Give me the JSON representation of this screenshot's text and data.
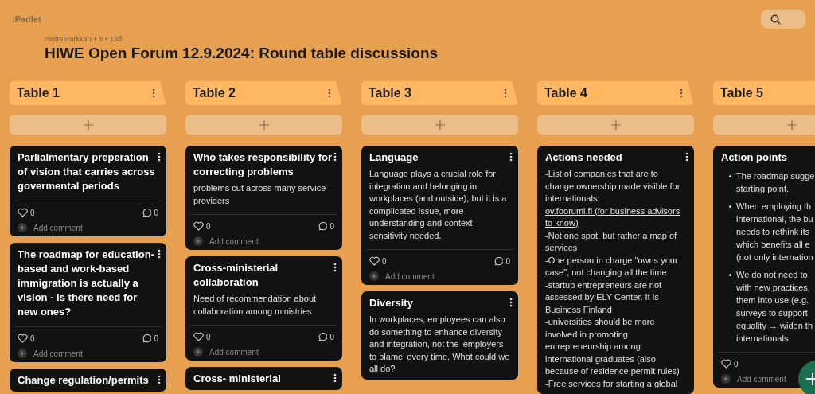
{
  "header": {
    "logo": ":Padlet",
    "meta": "Piritta Parkkari + 8 •  13d",
    "title": "HIWE Open Forum 12.9.2024: Round table discussions"
  },
  "columns": [
    {
      "title": "Table 1",
      "cards": [
        {
          "title": "Parlialmentary preperation of vision that carries across govermental periods",
          "likes": "0",
          "comments": "0",
          "add_comment": "Add comment"
        },
        {
          "title": "The roadmap for education-based and work-based immigration is actually a vision - is there need for new ones?",
          "likes": "0",
          "comments": "0",
          "add_comment": "Add comment"
        },
        {
          "title": "Change regulation/permits"
        }
      ]
    },
    {
      "title": "Table 2",
      "cards": [
        {
          "title": "Who takes responsibility for correcting problems",
          "body": [
            {
              "text": "problems cut across many service providers"
            }
          ],
          "likes": "0",
          "comments": "0",
          "add_comment": "Add comment"
        },
        {
          "title": "Cross-ministerial collaboration",
          "body": [
            {
              "text": "Need of recommendation about collaboration among ministries"
            }
          ],
          "likes": "0",
          "comments": "0",
          "add_comment": "Add comment"
        },
        {
          "title": "Cross- ministerial"
        }
      ]
    },
    {
      "title": "Table 3",
      "cards": [
        {
          "title": "Language",
          "body": [
            {
              "text": "Language plays a crucial role for integration and belonging in workplaces (and outside), but it is a complicated issue, more understanding and context-sensitivity needed."
            }
          ],
          "likes": "0",
          "comments": "0",
          "add_comment": "Add comment"
        },
        {
          "title": "Diversity",
          "body": [
            {
              "text": "In workplaces, employees can also do something to enhance diversity and integration, not the 'employers to blame' every time. What could we all do?"
            }
          ]
        }
      ]
    },
    {
      "title": "Table 4",
      "cards": [
        {
          "title": "Actions needed",
          "body": [
            {
              "text": "-List of companies that are to change ownership made visible for internationals: ",
              "link": "ov.foorumi.fi (for business advisors to know)"
            },
            {
              "text": "-Not one spot, but rather a map of services"
            },
            {
              "text": "-One person in charge \"owns your case\", not changing all the time"
            },
            {
              "text": "-startup entrepreneurs are not assessed by ELY Center. It is Business Finland"
            },
            {
              "text": "-universities should be more involved in promoting entrepreneurship among international graduates (also because of residence permit rules)"
            },
            {
              "text": "-Free services for starting a global"
            }
          ]
        }
      ]
    },
    {
      "title": "Table 5",
      "cards": [
        {
          "title": "Action points",
          "bullets": [
            [
              "The roadmap sugge",
              "starting point."
            ],
            [
              "When employing th",
              "international, the bu",
              "needs to rethink its",
              "which benefits all e",
              "(not only internation"
            ],
            [
              "We do not need to",
              "with new practices,",
              "them into use (e.g.",
              "surveys to support",
              "equality → widen th",
              "internationals"
            ]
          ],
          "likes": "0",
          "add_comment": "Add comment"
        }
      ]
    }
  ]
}
